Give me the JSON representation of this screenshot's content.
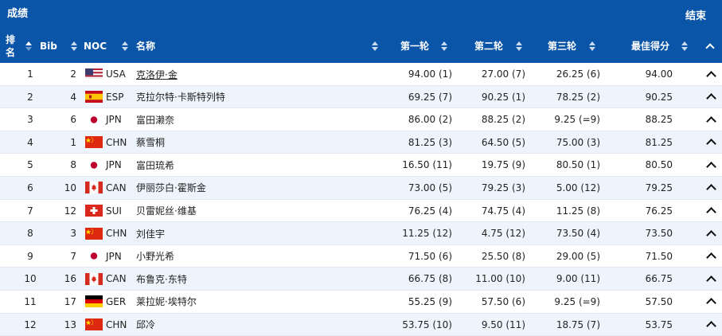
{
  "topbar": {
    "title": "成绩",
    "end_label": "结束"
  },
  "columns": {
    "rank": "排名",
    "bib": "Bib",
    "noc": "NOC",
    "name": "名称",
    "round1": "第一轮",
    "round2": "第二轮",
    "round3": "第三轮",
    "best": "最佳得分"
  },
  "rows": [
    {
      "rank": "1",
      "bib": "2",
      "flag": "usa-flag-icon",
      "noc": "USA",
      "name": "克洛伊·金",
      "r1": "94.00 (1)",
      "r2": "27.00 (7)",
      "r3": "26.25 (6)",
      "best": "94.00"
    },
    {
      "rank": "2",
      "bib": "4",
      "flag": "esp-flag-icon",
      "noc": "ESP",
      "name": "克拉尔特·卡斯特列特",
      "r1": "69.25 (7)",
      "r2": "90.25 (1)",
      "r3": "78.25 (2)",
      "best": "90.25"
    },
    {
      "rank": "3",
      "bib": "6",
      "flag": "jpn-flag-icon",
      "noc": "JPN",
      "name": "富田濑奈",
      "r1": "86.00 (2)",
      "r2": "88.25 (2)",
      "r3": "9.25 (=9)",
      "best": "88.25"
    },
    {
      "rank": "4",
      "bib": "1",
      "flag": "chn-flag-icon",
      "noc": "CHN",
      "name": "蔡雪桐",
      "r1": "81.25 (3)",
      "r2": "64.50 (5)",
      "r3": "75.00 (3)",
      "best": "81.25"
    },
    {
      "rank": "5",
      "bib": "8",
      "flag": "jpn-flag-icon",
      "noc": "JPN",
      "name": "富田琉希",
      "r1": "16.50 (11)",
      "r2": "19.75 (9)",
      "r3": "80.50 (1)",
      "best": "80.50"
    },
    {
      "rank": "6",
      "bib": "10",
      "flag": "can-flag-icon",
      "noc": "CAN",
      "name": "伊丽莎白·霍斯金",
      "r1": "73.00 (5)",
      "r2": "79.25 (3)",
      "r3": "5.00 (12)",
      "best": "79.25"
    },
    {
      "rank": "7",
      "bib": "12",
      "flag": "sui-flag-icon",
      "noc": "SUI",
      "name": "贝雷妮丝·维基",
      "r1": "76.25 (4)",
      "r2": "74.75 (4)",
      "r3": "11.25 (8)",
      "best": "76.25"
    },
    {
      "rank": "8",
      "bib": "3",
      "flag": "chn-flag-icon",
      "noc": "CHN",
      "name": "刘佳宇",
      "r1": "11.25 (12)",
      "r2": "4.75 (12)",
      "r3": "73.50 (4)",
      "best": "73.50"
    },
    {
      "rank": "9",
      "bib": "7",
      "flag": "jpn-flag-icon",
      "noc": "JPN",
      "name": "小野光希",
      "r1": "71.50 (6)",
      "r2": "25.50 (8)",
      "r3": "29.00 (5)",
      "best": "71.50"
    },
    {
      "rank": "10",
      "bib": "16",
      "flag": "can-flag-icon",
      "noc": "CAN",
      "name": "布鲁克·东特",
      "r1": "66.75 (8)",
      "r2": "11.00 (10)",
      "r3": "9.00 (11)",
      "best": "66.75"
    },
    {
      "rank": "11",
      "bib": "17",
      "flag": "ger-flag-icon",
      "noc": "GER",
      "name": "莱拉妮·埃特尔",
      "r1": "55.25 (9)",
      "r2": "57.50 (6)",
      "r3": "9.25 (=9)",
      "best": "57.50"
    },
    {
      "rank": "12",
      "bib": "13",
      "flag": "chn-flag-icon",
      "noc": "CHN",
      "name": "邱冷",
      "r1": "53.75 (10)",
      "r2": "9.50 (11)",
      "r3": "18.75 (7)",
      "best": "53.75"
    }
  ],
  "colors": {
    "header_bg": "#0b55a8",
    "row_alt_bg": "#eef4fb"
  }
}
